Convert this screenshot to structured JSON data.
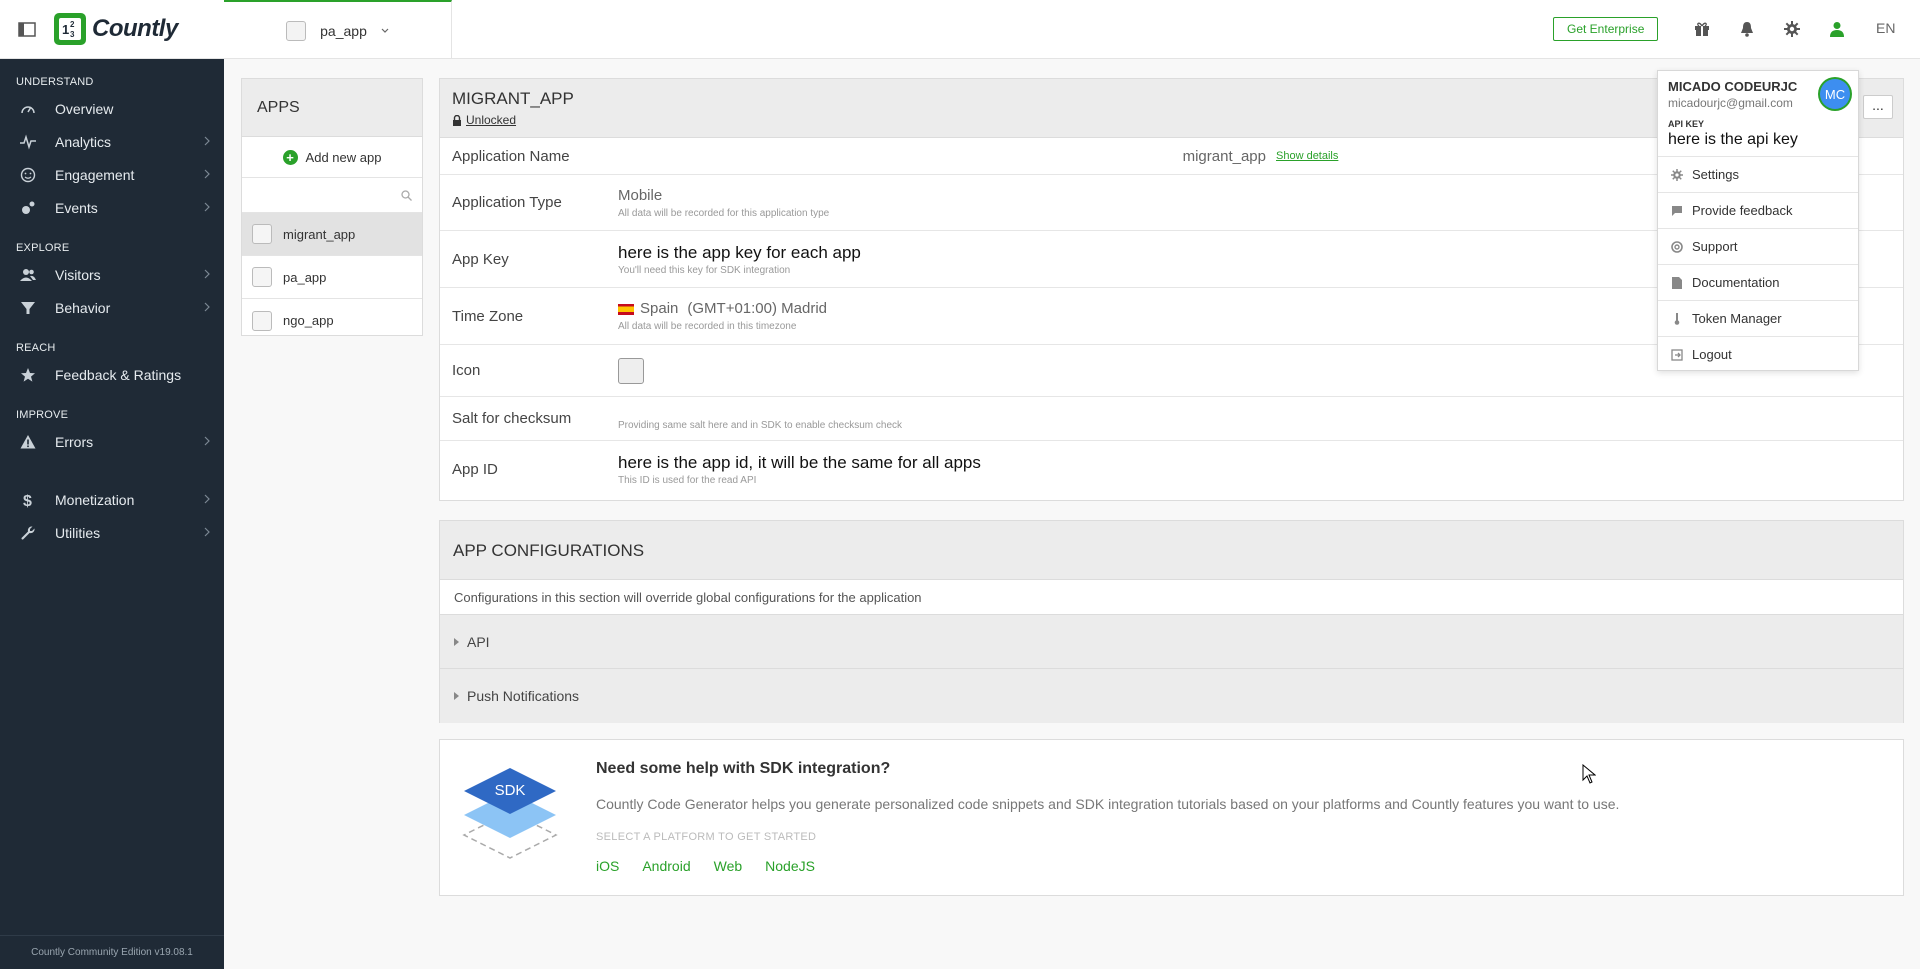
{
  "brand": {
    "name": "Countly",
    "accent": "#2aa12a",
    "sidebar_bg": "#1f2a36"
  },
  "topbar": {
    "current_app": "pa_app",
    "enterprise_label": "Get Enterprise",
    "language": "EN"
  },
  "sidebar": {
    "sections": [
      {
        "title": "UNDERSTAND",
        "items": [
          {
            "label": "Overview",
            "icon": "gauge-icon"
          },
          {
            "label": "Analytics",
            "icon": "pulse-icon"
          },
          {
            "label": "Engagement",
            "icon": "smile-icon"
          },
          {
            "label": "Events",
            "icon": "events-icon"
          }
        ]
      },
      {
        "title": "EXPLORE",
        "items": [
          {
            "label": "Visitors",
            "icon": "users-icon"
          },
          {
            "label": "Behavior",
            "icon": "funnel-icon"
          }
        ]
      },
      {
        "title": "REACH",
        "items": [
          {
            "label": "Feedback & Ratings",
            "icon": "star-icon"
          }
        ]
      },
      {
        "title": "IMPROVE",
        "items": [
          {
            "label": "Errors",
            "icon": "warning-icon"
          },
          {
            "label": "Monetization",
            "icon": "dollar-icon"
          },
          {
            "label": "Utilities",
            "icon": "wrench-icon"
          }
        ]
      }
    ],
    "footer": "Countly Community Edition v19.08.1"
  },
  "apps_panel": {
    "title": "APPS",
    "add_label": "Add new app",
    "search_placeholder": "",
    "apps": [
      "migrant_app",
      "pa_app",
      "ngo_app"
    ],
    "selected": "migrant_app"
  },
  "details": {
    "title": "MIGRANT_APP",
    "lock_status": "Unlocked",
    "more_label": "...",
    "rows": {
      "name": {
        "label": "Application Name",
        "value": "migrant_app",
        "link": "Show details"
      },
      "type": {
        "label": "Application Type",
        "value": "Mobile",
        "hint": "All data will be recorded for this application type"
      },
      "key": {
        "label": "App Key",
        "value": "here is the app key for each app",
        "hint": "You'll need this key for SDK integration"
      },
      "tz": {
        "label": "Time Zone",
        "country": "Spain",
        "value": "(GMT+01:00) Madrid",
        "hint": "All data will be recorded in this timezone"
      },
      "icon": {
        "label": "Icon"
      },
      "salt": {
        "label": "Salt for checksum",
        "hint": "Providing same salt here and in SDK to enable checksum check"
      },
      "appid": {
        "label": "App ID",
        "value": "here is the app id, it will be the same for all apps",
        "hint": "This ID is used for the read API"
      }
    }
  },
  "config": {
    "title": "APP CONFIGURATIONS",
    "description": "Configurations in this section will override global configurations for the application",
    "sections": [
      "API",
      "Push Notifications"
    ]
  },
  "sdk_help": {
    "badge": "SDK",
    "title": "Need some help with SDK integration?",
    "description": "Countly Code Generator helps you generate personalized code snippets and SDK integration tutorials based on your platforms and Countly features you want to use.",
    "select_label": "SELECT A PLATFORM TO GET STARTED",
    "platforms": [
      "iOS",
      "Android",
      "Web",
      "NodeJS"
    ]
  },
  "user_menu": {
    "name": "MICADO CODEURJC",
    "email": "micadourjc@gmail.com",
    "initials": "MC",
    "api_key_label": "API KEY",
    "api_key_value": "here is the api key",
    "items": [
      {
        "label": "Settings",
        "icon": "gear-icon"
      },
      {
        "label": "Provide feedback",
        "icon": "comment-icon"
      },
      {
        "label": "Support",
        "icon": "lifebuoy-icon"
      },
      {
        "label": "Documentation",
        "icon": "document-icon"
      },
      {
        "label": "Token Manager",
        "icon": "thermometer-icon"
      },
      {
        "label": "Logout",
        "icon": "logout-icon"
      }
    ]
  }
}
